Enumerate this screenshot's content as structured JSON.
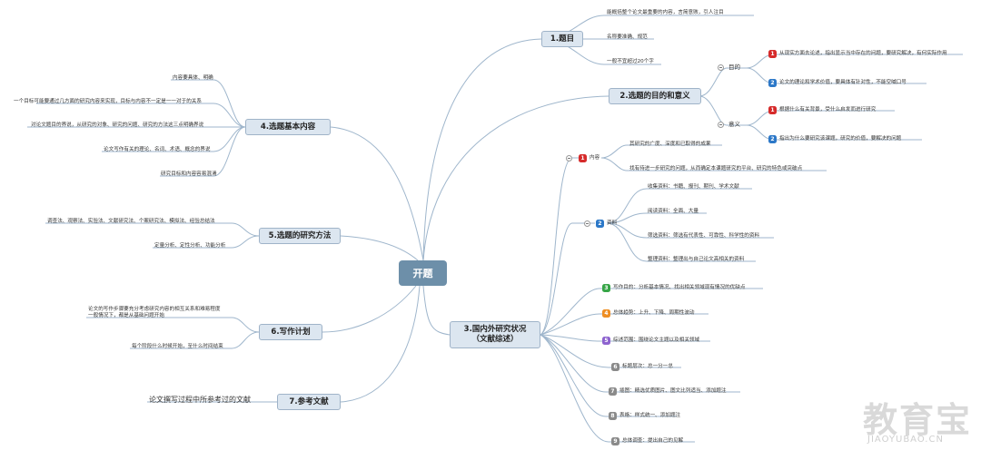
{
  "central": "开题",
  "branch1": {
    "title": "1.题目",
    "items": [
      "能概括整个论文最重要的内容，言简意赅，引人注目",
      "名称要准确、规范",
      "一般不宜超过20个字"
    ]
  },
  "branch2": {
    "title": "2.选题的目的和意义",
    "purpose_label": "目的",
    "purpose_items": [
      {
        "n": "1",
        "text": "从现实方面去论述，指出显示当中存在的问题，要研究解决，有何实际作用"
      },
      {
        "n": "2",
        "text": "论文的理论和学术价值，要具体有针对性，不能空喊口号"
      }
    ],
    "meaning_label": "意义",
    "meaning_items": [
      {
        "n": "1",
        "text": "根据什么有关背景，受什么启发而进行研究"
      },
      {
        "n": "2",
        "text": "指出为什么要研究该课题，研究的价值，要解决的问题"
      }
    ]
  },
  "branch3": {
    "title_line1": "3.国内外研究状况",
    "title_line2": "（文献综述）",
    "content": {
      "n": "1",
      "label": "内容",
      "items": [
        "其研究的广度、深度和已取得的成果",
        "找有待进一步研究的问题，从而确定本课题研究的平台、研究的特色或突破点"
      ]
    },
    "materials": {
      "n": "2",
      "label": "资料",
      "items": [
        "收集资料：书籍、报刊、期刊、学术文献",
        "阅读资料：全面、大量",
        "筛选资料：筛选有代表性、可靠性、科学性的资料",
        "整理资料：整理出与自己论文高相关的资料"
      ]
    },
    "others": [
      {
        "n": "3",
        "color": "green",
        "text": "写作目的：分析基本情况、找出相关领域现有情况的优缺点"
      },
      {
        "n": "4",
        "color": "orange",
        "text": "总体趋势：上升、下降、周期性波动"
      },
      {
        "n": "5",
        "color": "purple",
        "text": "综述范围：围绕论文主题以及相关领域"
      },
      {
        "n": "6",
        "color": "gray",
        "text": "标题层次：总一分一总"
      },
      {
        "n": "7",
        "color": "gray",
        "text": "插图：精选优质图片、图文比列适当、添加题注"
      },
      {
        "n": "8",
        "color": "gray",
        "text": "表格：样式统一、添加题注"
      },
      {
        "n": "9",
        "color": "gray",
        "text": "总体调查：提出自己的见解"
      }
    ]
  },
  "branch4": {
    "title": "4.选题基本内容",
    "items": [
      "内容要具体、明确",
      "一个目标可能要通过几方面的研究内容来实现，目标与内容不一定是一一对于的关系",
      "对论文题目的界说，从研究的对象、研究的问题、研究的方法这三点明确界说",
      "论文写作有关的理论、名词、术语、概念的界说",
      "研究目标和内容容易混淆"
    ]
  },
  "branch5": {
    "title": "5.选题的研究方法",
    "items": [
      "调查法、观察法、实验法、文献研究法、个案研究法、模拟法、经验总结法",
      "定量分析、定性分析、功能分析"
    ]
  },
  "branch6": {
    "title": "6.写作计划",
    "items_line1": "论文的写作步骤要充分考虑研究内容的相互关系和难易程度",
    "items_line2": "一般情况下，都是从基础问题开始",
    "item2": "每个阶段什么时候开始，至什么时间结束"
  },
  "branch7": {
    "title": "7.参考文献",
    "item": "论文撰写过程中所参考过的文献"
  },
  "watermark": {
    "main": "教育宝",
    "sub": "JIAOYUBAO.CN"
  },
  "colors": {
    "line": "#9fb6cc",
    "central": "#6d8fa9",
    "topic_bg": "#dce6f0",
    "red": "#d62b2b",
    "blue": "#2c78c8",
    "green": "#37a547",
    "orange": "#ee8e23",
    "purple": "#8d63cf",
    "gray": "#8a8a8a"
  }
}
